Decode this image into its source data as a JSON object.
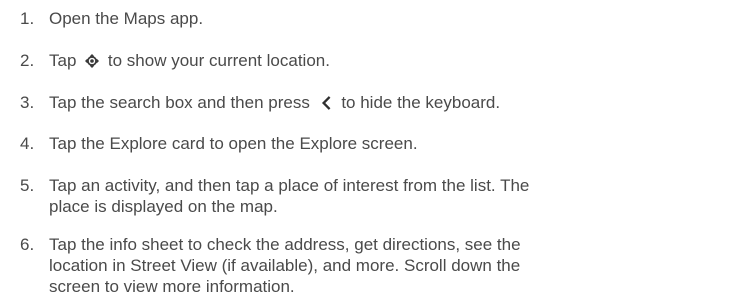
{
  "instructions": {
    "steps": [
      {
        "number": "1.",
        "text": "Open the Maps app."
      },
      {
        "number": "2.",
        "before_icon": "Tap",
        "icon": "location-target-icon",
        "after_icon": "to show your current location."
      },
      {
        "number": "3.",
        "before_icon": "Tap the search box and then press",
        "icon": "back-chevron-icon",
        "after_icon": "to hide the keyboard."
      },
      {
        "number": "4.",
        "text": "Tap the Explore card to open the Explore screen."
      },
      {
        "number": "5.",
        "line1": "Tap an activity, and then tap a place of interest from the list. The",
        "line2": "place is displayed on the map."
      },
      {
        "number": "6.",
        "line1": "Tap the info sheet to check the address, get directions, see the",
        "line2": "location in Street View (if available), and more. Scroll down the",
        "line3": "screen to view more information."
      }
    ]
  }
}
